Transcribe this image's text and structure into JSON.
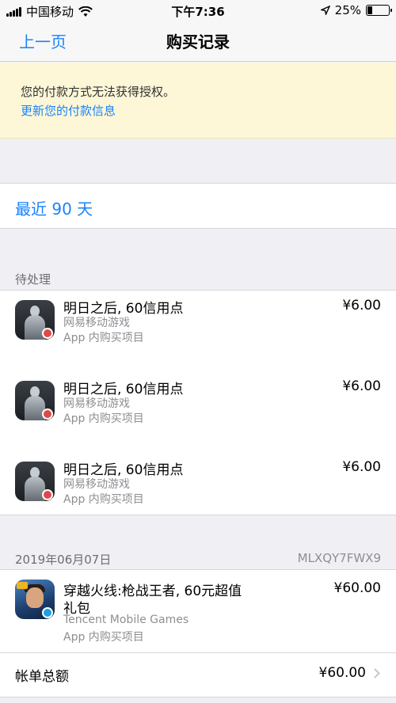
{
  "status_bar": {
    "carrier": "中国移动",
    "time": "下午7:36",
    "battery": "25%",
    "battery_level": 0.25
  },
  "nav": {
    "back_label": "上一页",
    "title": "购买记录"
  },
  "alert": {
    "message": "您的付款方式无法获得授权。",
    "link": "更新您的付款信息"
  },
  "filter": {
    "label": "最近 90 天"
  },
  "pending": {
    "header": "待处理",
    "items": [
      {
        "title": "明日之后, 60信用点",
        "developer": "网易移动游戏",
        "type": "App 内购买项目",
        "price": "¥6.00",
        "icon": "game-icon-silhouette"
      },
      {
        "title": "明日之后, 60信用点",
        "developer": "网易移动游戏",
        "type": "App 内购买项目",
        "price": "¥6.00",
        "icon": "game-icon-silhouette"
      },
      {
        "title": "明日之后, 60信用点",
        "developer": "网易移动游戏",
        "type": "App 内购买项目",
        "price": "¥6.00",
        "icon": "game-icon-silhouette"
      }
    ]
  },
  "order": {
    "date": "2019年06月07日",
    "order_id": "MLXQY7FWX9",
    "item": {
      "title_line1": "穿越火线:枪战王者, 60元超值",
      "title_line2": "礼包",
      "developer": "Tencent Mobile Games",
      "type": "App 内购买项目",
      "price": "¥60.00",
      "icon": "game-icon-crossfire"
    },
    "total_label": "帐单总额",
    "total_amount": "¥60.00"
  },
  "colors": {
    "accent": "#1a82fb",
    "alert_bg": "#fdf7d8",
    "page_bg": "#efeff4"
  }
}
